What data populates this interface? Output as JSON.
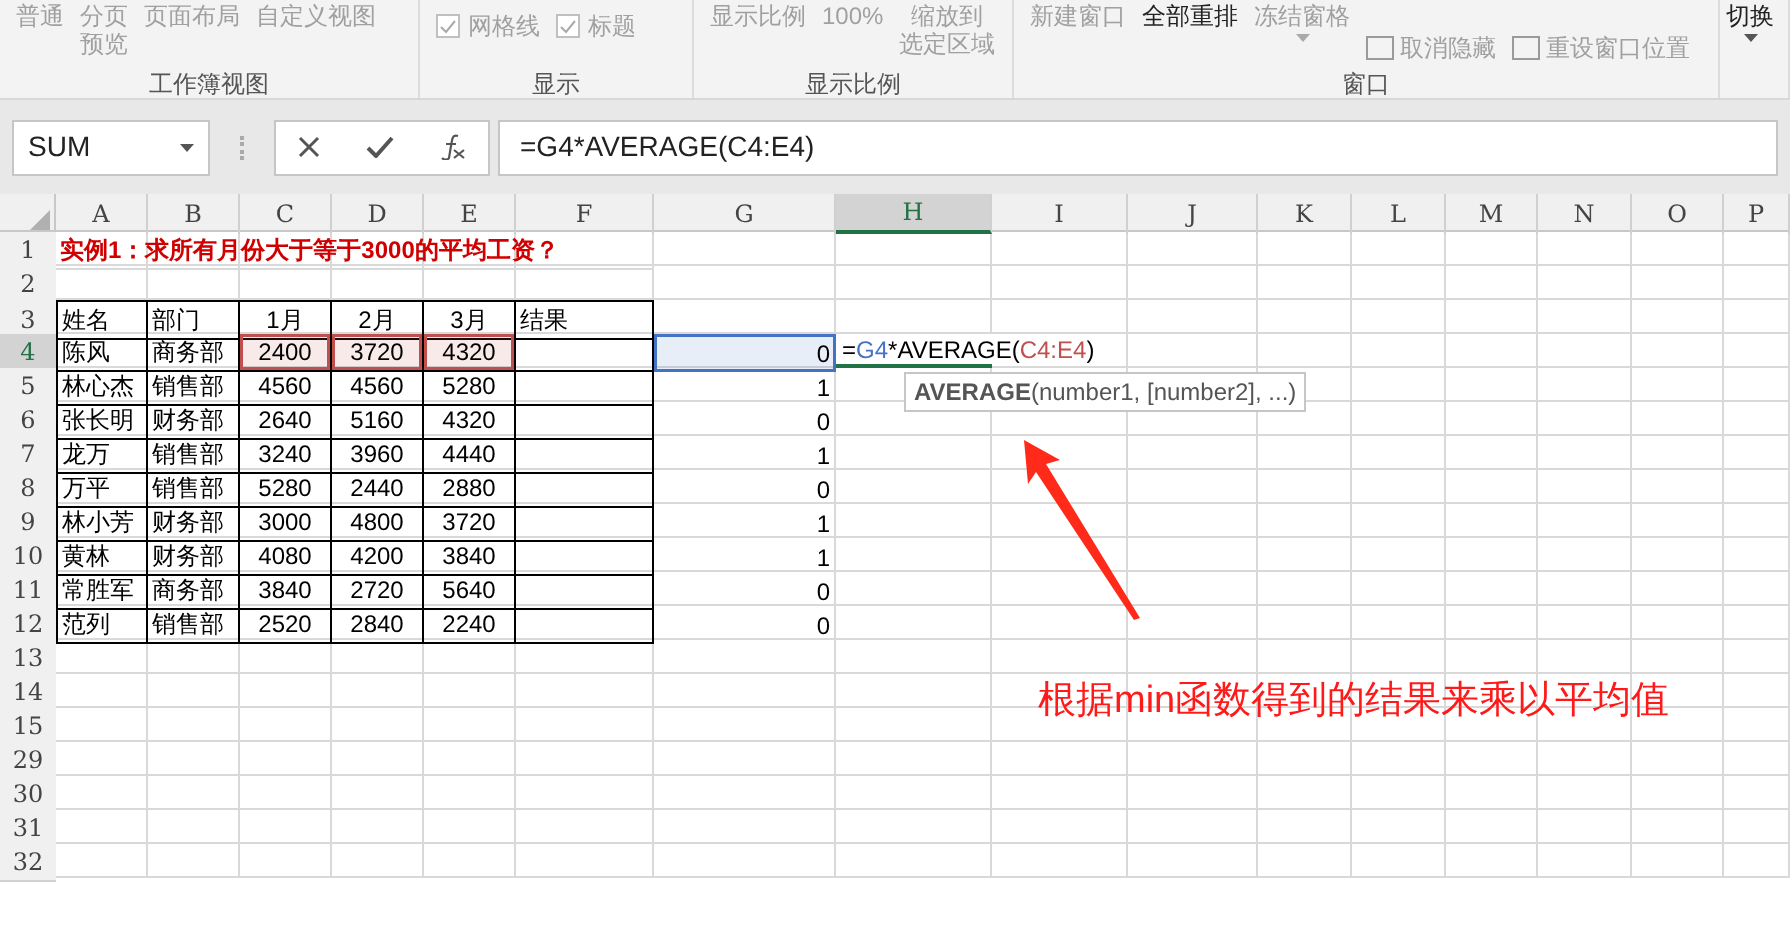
{
  "ribbon": {
    "groups": [
      {
        "label": "工作簿视图",
        "items": [
          {
            "lines": [
              "普通"
            ],
            "disabled": true
          },
          {
            "lines": [
              "分页",
              "预览"
            ],
            "disabled": true
          },
          {
            "lines": [
              "页面布局"
            ],
            "disabled": true
          },
          {
            "lines": [
              "自定义视图"
            ],
            "disabled": true
          }
        ]
      },
      {
        "label": "显示",
        "checkboxes": [
          {
            "text": "网格线",
            "checked": true
          },
          {
            "text": "标题",
            "checked": true
          }
        ]
      },
      {
        "label": "显示比例",
        "items": [
          {
            "lines": [
              "显示比例"
            ],
            "disabled": true
          },
          {
            "lines": [
              "100%"
            ],
            "disabled": true
          },
          {
            "lines": [
              "缩放到",
              "选定区域"
            ],
            "disabled": true
          }
        ]
      },
      {
        "label": "窗口",
        "items": [
          {
            "lines": [
              "新建窗口"
            ],
            "disabled": true
          },
          {
            "lines": [
              "全部重排"
            ],
            "disabled": false
          },
          {
            "lines": [
              "冻结窗格"
            ],
            "disabled": true,
            "dropdown": true
          }
        ],
        "side_items": [
          {
            "text": "取消隐藏",
            "disabled": true
          },
          {
            "text": "重设窗口位置",
            "disabled": true
          }
        ]
      },
      {
        "items": [
          {
            "lines": [
              "切换"
            ],
            "disabled": false,
            "dropdown": true
          }
        ]
      }
    ]
  },
  "name_box": "SUM",
  "formula": "=G4*AVERAGE(C4:E4)",
  "columns": [
    {
      "label": "A",
      "selected": false
    },
    {
      "label": "B",
      "selected": false
    },
    {
      "label": "C",
      "selected": false
    },
    {
      "label": "D",
      "selected": false
    },
    {
      "label": "E",
      "selected": false
    },
    {
      "label": "F",
      "selected": false
    },
    {
      "label": "G",
      "selected": false
    },
    {
      "label": "H",
      "selected": true
    },
    {
      "label": "I",
      "selected": false
    },
    {
      "label": "J",
      "selected": false
    },
    {
      "label": "K",
      "selected": false
    },
    {
      "label": "L",
      "selected": false
    },
    {
      "label": "M",
      "selected": false
    },
    {
      "label": "N",
      "selected": false
    },
    {
      "label": "O",
      "selected": false
    },
    {
      "label": "P",
      "selected": false
    }
  ],
  "rows": [
    {
      "header": "1",
      "selected": false,
      "title": "实例1：求所有月份大于等于3000的平均工资？"
    },
    {
      "header": "2",
      "selected": false
    },
    {
      "header": "3",
      "selected": false,
      "cells": [
        "姓名",
        "部门",
        "1月",
        "2月",
        "3月",
        "结果",
        null
      ]
    },
    {
      "header": "4",
      "selected": true,
      "cells": [
        "陈风",
        "商务部",
        {
          "text": "2400",
          "color": "#c0504d"
        },
        {
          "text": "3720",
          "color": "#c0504d"
        },
        {
          "text": "4320",
          "color": "#c0504d"
        },
        null,
        {
          "text": "0",
          "color": "#4472c4"
        }
      ]
    },
    {
      "header": "5",
      "selected": false,
      "cells": [
        "林心杰",
        "销售部",
        "4560",
        "4560",
        "5280",
        null,
        "1"
      ]
    },
    {
      "header": "6",
      "selected": false,
      "cells": [
        "张长明",
        "财务部",
        "2640",
        "5160",
        "4320",
        null,
        "0"
      ]
    },
    {
      "header": "7",
      "selected": false,
      "cells": [
        "龙万",
        "销售部",
        "3240",
        "3960",
        "4440",
        null,
        "1"
      ]
    },
    {
      "header": "8",
      "selected": false,
      "cells": [
        "万平",
        "销售部",
        "5280",
        "2440",
        "2880",
        null,
        "0"
      ]
    },
    {
      "header": "9",
      "selected": false,
      "cells": [
        "林小芳",
        "财务部",
        "3000",
        "4800",
        "3720",
        null,
        "1"
      ]
    },
    {
      "header": "10",
      "selected": false,
      "cells": [
        "黄林",
        "财务部",
        "4080",
        "4200",
        "3840",
        null,
        "1"
      ]
    },
    {
      "header": "11",
      "selected": false,
      "cells": [
        "常胜军",
        "商务部",
        "3840",
        "2720",
        "5640",
        null,
        "0"
      ]
    },
    {
      "header": "12",
      "selected": false,
      "cells": [
        "范列",
        "销售部",
        "2520",
        "2840",
        "2240",
        null,
        "0"
      ]
    },
    {
      "header": "13",
      "selected": false
    },
    {
      "header": "14",
      "selected": false
    },
    {
      "header": "15",
      "selected": false
    },
    {
      "header": "29",
      "selected": false
    },
    {
      "header": "30",
      "selected": false
    },
    {
      "header": "31",
      "selected": false
    },
    {
      "header": "32",
      "selected": false
    }
  ],
  "editing_cell": {
    "parts": [
      {
        "text": "=",
        "color": "#000000"
      },
      {
        "text": "G4",
        "color": "#4472c4"
      },
      {
        "text": "*AVERAGE(",
        "color": "#000000"
      },
      {
        "text": "C4:E4",
        "color": "#c0504d"
      },
      {
        "text": ")",
        "color": "#000000"
      }
    ]
  },
  "tooltip": {
    "function": "AVERAGE",
    "args": "(number1, [number2], ...)"
  },
  "annotation": "根据min函数得到的结果来乘以平均值"
}
